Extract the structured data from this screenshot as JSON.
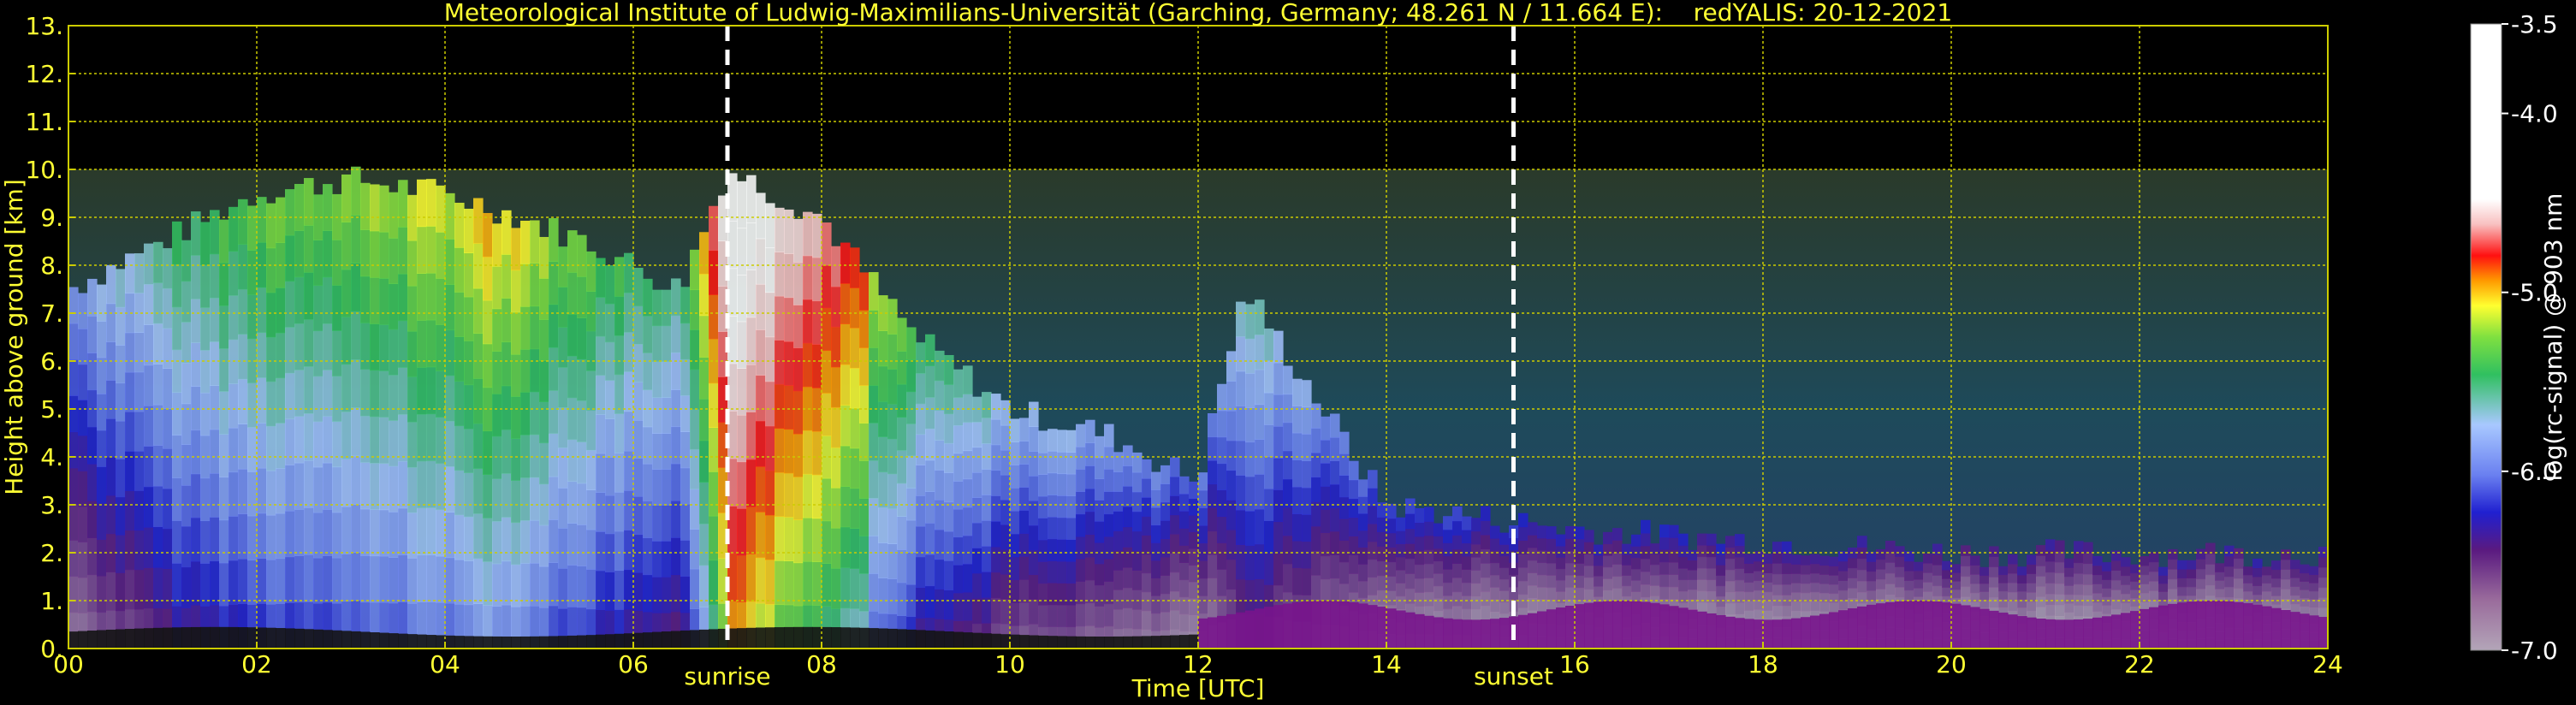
{
  "chart_data": {
    "type": "heatmap",
    "title": "Meteorological Institute of Ludwig-Maximilians-Universität (Garching, Germany; 48.261 N / 11.664 E):    redYALIS: 20-12-2021",
    "xlabel": "Time [UTC]",
    "ylabel": "Height above ground [km]",
    "xlim": [
      0,
      24
    ],
    "ylim": [
      0,
      13
    ],
    "x_ticks": [
      0,
      2,
      4,
      6,
      8,
      10,
      12,
      14,
      16,
      18,
      20,
      22,
      24
    ],
    "x_tick_labels": [
      "00",
      "02",
      "04",
      "06",
      "08",
      "10",
      "12",
      "14",
      "16",
      "18",
      "20",
      "22",
      "24"
    ],
    "y_ticks": [
      0,
      1,
      2,
      3,
      4,
      5,
      6,
      7,
      8,
      9,
      10,
      11,
      12,
      13
    ],
    "y_tick_labels": [
      "0.",
      "1.",
      "2.",
      "3.",
      "4.",
      "5.",
      "6.",
      "7.",
      "8.",
      "9.",
      "10.",
      "11.",
      "12.",
      "13."
    ],
    "grid": true,
    "data_top_km": 10,
    "markers": [
      {
        "label": "sunrise",
        "time": 7.0
      },
      {
        "label": "sunset",
        "time": 15.35
      }
    ],
    "colorbar": {
      "label": "log(rc-signal) @ 903 nm",
      "min": -7.0,
      "max": -3.5,
      "tick_values": [
        -3.5,
        -4.0,
        -5.0,
        -6.0,
        -7.0
      ],
      "tick_labels": [
        "-3.5",
        "-4.0",
        "-5.0",
        "-6.0",
        "-7.0"
      ]
    },
    "colors": {
      "text": "#ffff33",
      "grid": "#cccc00",
      "colorbar_text": "#ffffff",
      "marker_line": "#ffffff"
    },
    "signal_profile": [
      {
        "t": 0.0,
        "top": 7.5,
        "v": -5.9
      },
      {
        "t": 1.0,
        "top": 8.5,
        "v": -5.5
      },
      {
        "t": 2.0,
        "top": 9.5,
        "v": -5.3
      },
      {
        "t": 3.0,
        "top": 9.8,
        "v": -5.2
      },
      {
        "t": 4.0,
        "top": 9.5,
        "v": -5.1
      },
      {
        "t": 4.5,
        "top": 9.2,
        "v": -5.0
      },
      {
        "t": 5.5,
        "top": 8.5,
        "v": -5.3
      },
      {
        "t": 6.5,
        "top": 7.5,
        "v": -5.5
      },
      {
        "t": 7.0,
        "top": 10.0,
        "v": -4.3
      },
      {
        "t": 8.0,
        "top": 9.0,
        "v": -4.8
      },
      {
        "t": 9.0,
        "top": 6.5,
        "v": -5.4
      },
      {
        "t": 10.0,
        "top": 5.0,
        "v": -5.7
      },
      {
        "t": 11.0,
        "top": 4.5,
        "v": -5.8
      },
      {
        "t": 12.0,
        "top": 3.5,
        "v": -6.0
      },
      {
        "t": 12.5,
        "top": 7.5,
        "v": -5.6
      },
      {
        "t": 14.0,
        "top": 3.0,
        "v": -6.1
      },
      {
        "t": 16.0,
        "top": 2.5,
        "v": -6.2
      },
      {
        "t": 20.0,
        "top": 2.0,
        "v": -6.3
      },
      {
        "t": 24.0,
        "top": 2.0,
        "v": -6.3
      }
    ]
  }
}
